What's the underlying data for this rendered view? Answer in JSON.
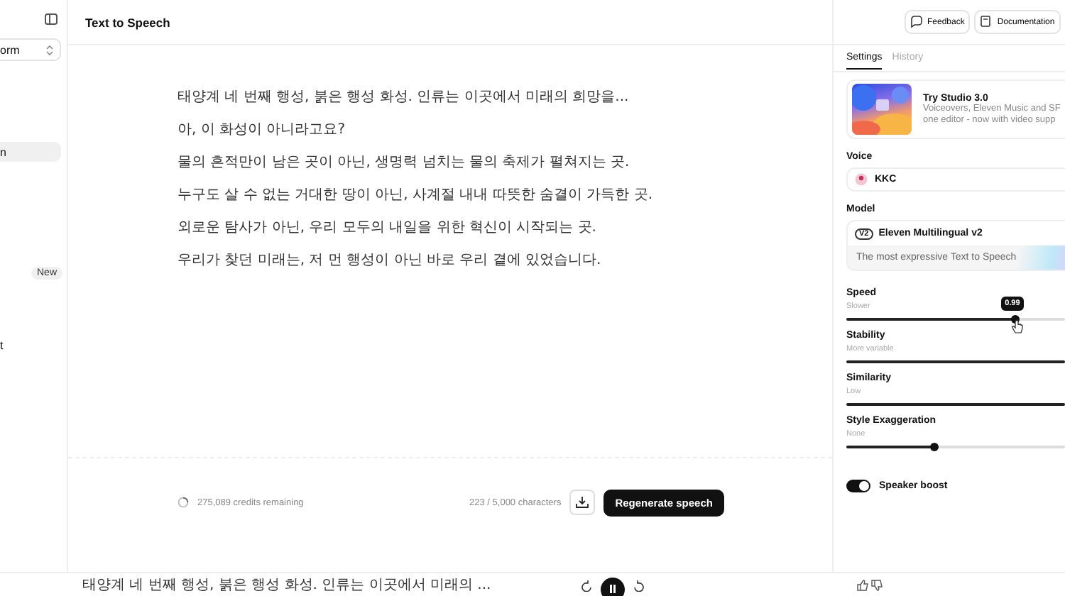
{
  "sidebar": {
    "selector": "orm",
    "items": [
      {
        "label": "n",
        "selected": true
      },
      {
        "label": "t",
        "selected": false
      }
    ],
    "badge": "New"
  },
  "header": {
    "title": "Text to Speech",
    "buttons": [
      "Feedback",
      "Documentation"
    ]
  },
  "editor": {
    "lines": [
      "태양계 네 번째 행성, 붉은 행성 화성. 인류는 이곳에서 미래의 희망을...",
      "아, 이 화성이 아니라고요?",
      "물의 흔적만이 남은 곳이 아닌, 생명력 넘치는 물의 축제가 펼쳐지는 곳.",
      "누구도 살 수 없는 거대한 땅이 아닌, 사계절 내내 따뜻한 숨결이 가득한 곳.",
      "외로운 탐사가 아닌, 우리 모두의 내일을 위한 혁신이 시작되는 곳.",
      "우리가 찾던 미래는, 저 먼 행성이 아닌 바로 우리 곁에 있었습니다."
    ],
    "credits": "275,089 credits remaining",
    "char_count": "223 / 5,000 characters",
    "generate_button": "Regenerate speech"
  },
  "settings": {
    "tabs": [
      {
        "label": "Settings",
        "selected": true
      },
      {
        "label": "History",
        "selected": false
      }
    ],
    "promo": {
      "kind": "picture",
      "title": "Try Studio 3.0",
      "lines": [
        "Voiceovers, Eleven Music and SF",
        "one editor - now with video supp"
      ]
    },
    "voice": {
      "label": "Voice",
      "value": "KKC"
    },
    "model": {
      "label": "Model",
      "badge": "V2",
      "value": "Eleven Multilingual v2",
      "description": "The most expressive Text to Speech"
    },
    "sliders": [
      {
        "label": "Speed",
        "hint": "Slower",
        "level": 0.77,
        "tooltip": "0.99"
      },
      {
        "label": "Stability",
        "hint": "More variable",
        "level": 1
      },
      {
        "label": "Similarity",
        "hint": "Low",
        "level": 1
      },
      {
        "label": "Style Exaggeration",
        "hint": "None",
        "level": 0.4
      }
    ],
    "speaker_boost": {
      "label": "Speaker boost",
      "on": true
    }
  },
  "player": {
    "title": "태양계 네 번째 행성, 붉은 행성 화성. 인류는 이곳에서 미래의 ...",
    "playing": true
  }
}
